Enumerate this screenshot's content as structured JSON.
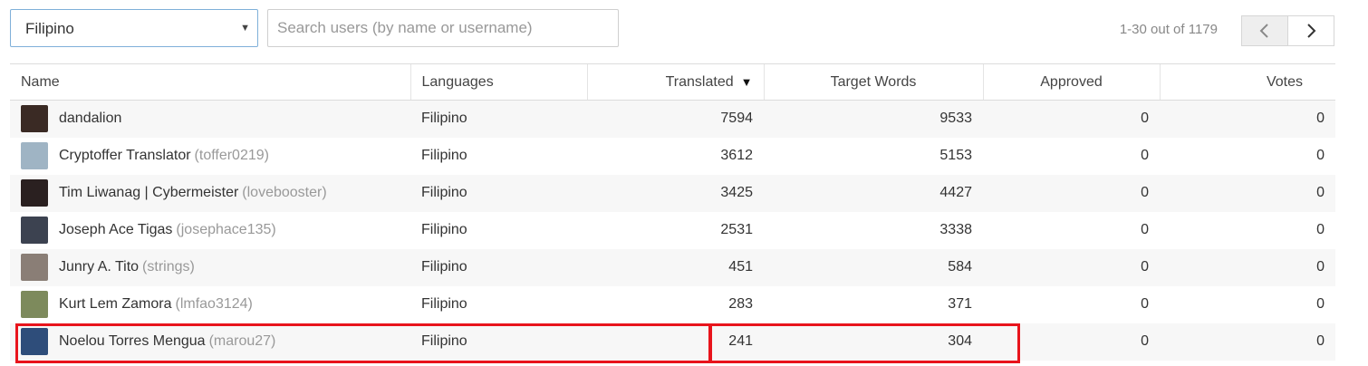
{
  "filters": {
    "language_selected": "Filipino",
    "search_placeholder": "Search users (by name or username)"
  },
  "pagination": {
    "range_text": "1-30 out of 1179"
  },
  "table": {
    "headers": {
      "name": "Name",
      "languages": "Languages",
      "translated": "Translated",
      "target_words": "Target Words",
      "approved": "Approved",
      "votes": "Votes"
    },
    "sort_indicator": "▼",
    "rows": [
      {
        "name": "dandalion",
        "username": "",
        "language": "Filipino",
        "translated": "7594",
        "target_words": "9533",
        "approved": "0",
        "votes": "0",
        "avatar_color": "#3a2a24"
      },
      {
        "name": "Cryptoffer Translator",
        "username": "(toffer0219)",
        "language": "Filipino",
        "translated": "3612",
        "target_words": "5153",
        "approved": "0",
        "votes": "0",
        "avatar_color": "#9fb4c4"
      },
      {
        "name": "Tim Liwanag | Cybermeister",
        "username": "(lovebooster)",
        "language": "Filipino",
        "translated": "3425",
        "target_words": "4427",
        "approved": "0",
        "votes": "0",
        "avatar_color": "#2a2020"
      },
      {
        "name": "Joseph Ace Tigas",
        "username": "(josephace135)",
        "language": "Filipino",
        "translated": "2531",
        "target_words": "3338",
        "approved": "0",
        "votes": "0",
        "avatar_color": "#3c4250"
      },
      {
        "name": "Junry A. Tito",
        "username": "(strings)",
        "language": "Filipino",
        "translated": "451",
        "target_words": "584",
        "approved": "0",
        "votes": "0",
        "avatar_color": "#8a7e76"
      },
      {
        "name": "Kurt Lem Zamora",
        "username": "(lmfao3124)",
        "language": "Filipino",
        "translated": "283",
        "target_words": "371",
        "approved": "0",
        "votes": "0",
        "avatar_color": "#7d8a5c"
      },
      {
        "name": "Noelou Torres Mengua",
        "username": "(marou27)",
        "language": "Filipino",
        "translated": "241",
        "target_words": "304",
        "approved": "0",
        "votes": "0",
        "avatar_color": "#2e4d7a"
      }
    ]
  },
  "colors": {
    "highlight": "#e8141c",
    "select_border": "#7fb0d9"
  }
}
